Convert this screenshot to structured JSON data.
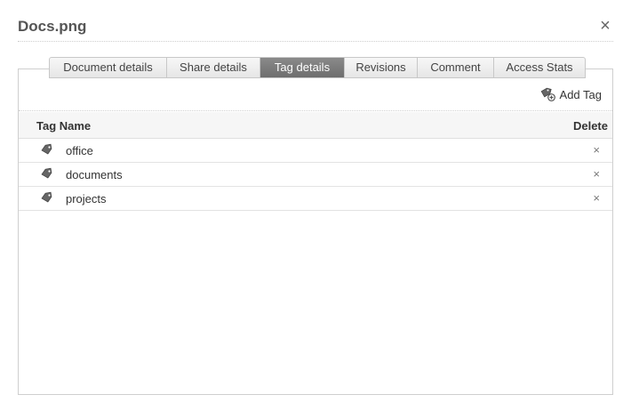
{
  "dialog": {
    "title": "Docs.png",
    "close_symbol": "×"
  },
  "tabs": [
    {
      "label": "Document details",
      "active": false
    },
    {
      "label": "Share details",
      "active": false
    },
    {
      "label": "Tag details",
      "active": true
    },
    {
      "label": "Revisions",
      "active": false
    },
    {
      "label": "Comment",
      "active": false
    },
    {
      "label": "Access Stats",
      "active": false
    }
  ],
  "toolbar": {
    "add_tag_label": "Add Tag",
    "add_tag_icon": "tag-add-icon"
  },
  "table": {
    "columns": {
      "name": "Tag Name",
      "delete": "Delete"
    },
    "row_icon": "tag-icon",
    "delete_symbol": "×",
    "rows": [
      {
        "name": "office"
      },
      {
        "name": "documents"
      },
      {
        "name": "projects"
      }
    ]
  }
}
